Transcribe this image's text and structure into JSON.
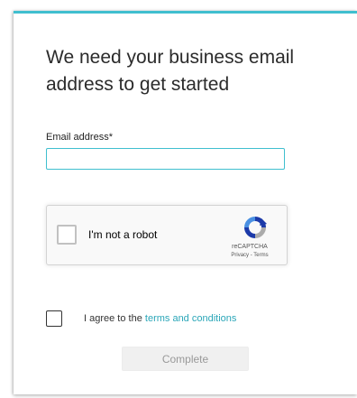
{
  "form": {
    "heading": "We need your business email address to get started",
    "email_label": "Email address*",
    "email_value": "",
    "email_placeholder": "",
    "terms_prefix": "I agree to the ",
    "terms_link": "terms and conditions",
    "complete_label": "Complete",
    "accent_color": "#40bfcf"
  },
  "recaptcha": {
    "checkbox_label": "I'm not a robot",
    "brand": "reCAPTCHA",
    "privacy_link": "Privacy",
    "separator": " - ",
    "terms_link": "Terms",
    "logo_icon": "recaptcha-logo-icon"
  }
}
